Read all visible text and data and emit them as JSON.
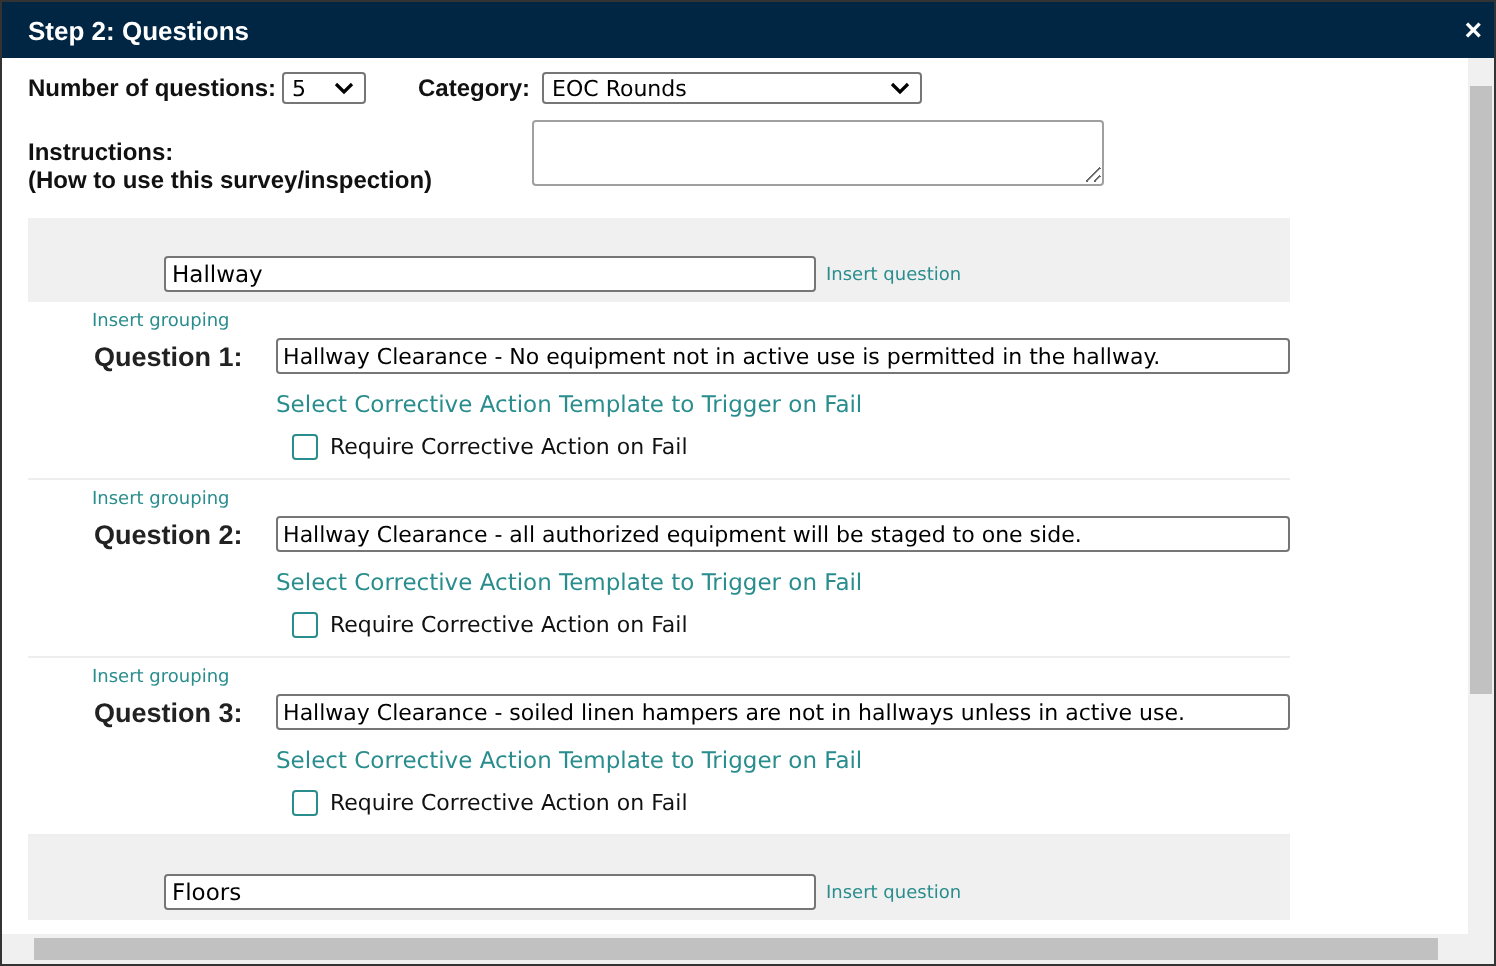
{
  "window": {
    "title": "Step 2: Questions",
    "close": "×"
  },
  "number_of_questions": {
    "label": "Number of questions:",
    "value": "5"
  },
  "category": {
    "label": "Category:",
    "value": "EOC Rounds"
  },
  "instructions": {
    "label": "Instructions:",
    "hint": "(How to use this survey/inspection)"
  },
  "groups": [
    {
      "name": "Hallway",
      "insert_question": "Insert question",
      "questions": [
        {
          "insert_grouping": "Insert grouping",
          "label": "Question 1:",
          "text": "Hallway Clearance - No equipment not in active use is permitted in the hallway.",
          "template_link": "Select Corrective Action Template to Trigger on Fail",
          "require_label": "Require Corrective Action on Fail",
          "checked": false
        },
        {
          "insert_grouping": "Insert grouping",
          "label": "Question 2:",
          "text": "Hallway Clearance - all authorized equipment will be staged to one side.",
          "template_link": "Select Corrective Action Template to Trigger on Fail",
          "require_label": "Require Corrective Action on Fail",
          "checked": false
        },
        {
          "insert_grouping": "Insert grouping",
          "label": "Question 3:",
          "text": "Hallway Clearance - soiled linen hampers are not in hallways unless in active use.",
          "template_link": "Select Corrective Action Template to Trigger on Fail",
          "require_label": "Require Corrective Action on Fail",
          "checked": false
        }
      ]
    },
    {
      "name": "Floors",
      "insert_question": "Insert question"
    }
  ]
}
